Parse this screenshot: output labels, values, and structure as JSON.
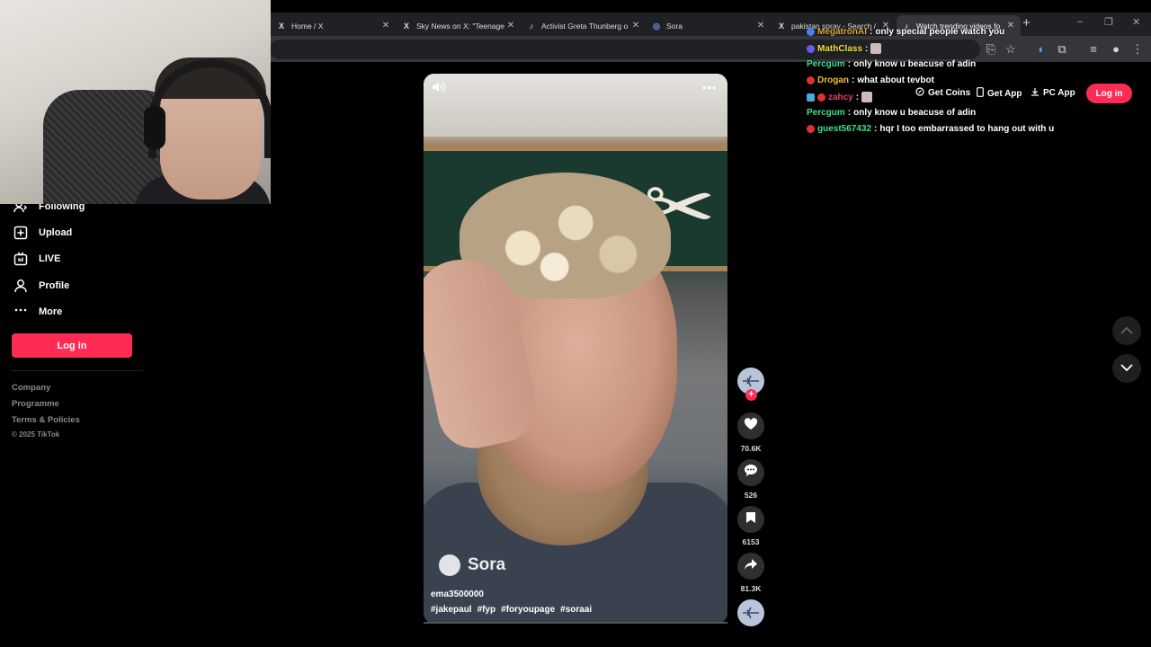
{
  "browser": {
    "tabs": [
      {
        "title": "Home / X",
        "icon": "X"
      },
      {
        "title": "Sky News on X: \"Teenage",
        "icon": "X"
      },
      {
        "title": "Activist Greta Thunberg o",
        "icon": "♪"
      },
      {
        "title": "Sora",
        "icon": "◎"
      },
      {
        "title": "pakistan spray - Search /",
        "icon": "X"
      },
      {
        "title": "Watch trending videos fo",
        "icon": "♪"
      }
    ],
    "new_tab": "+",
    "window_controls": [
      "–",
      "❐",
      "✕"
    ]
  },
  "sidebar": {
    "items": [
      {
        "label": "Following",
        "icon": "following-icon"
      },
      {
        "label": "Upload",
        "icon": "upload-icon"
      },
      {
        "label": "LIVE",
        "icon": "live-icon"
      },
      {
        "label": "Profile",
        "icon": "profile-icon"
      },
      {
        "label": "More",
        "icon": "more-icon"
      }
    ],
    "login_label": "Log in",
    "footer": {
      "company": "Company",
      "programme": "Programme",
      "terms": "Terms & Policies",
      "copyright": "© 2025 TikTok"
    }
  },
  "header": {
    "get_coins": "Get Coins",
    "get_app": "Get App",
    "pc_app": "PC App",
    "login_label": "Log in"
  },
  "video": {
    "watermark": "Sora",
    "author": "ema3500000",
    "hashtags": [
      "#jakepaul",
      "#fyp",
      "#foryoupage",
      "#soraai"
    ],
    "likes": "70.6K",
    "comments": "526",
    "saves": "6153",
    "shares": "81.3K"
  },
  "chat": [
    {
      "user": "MegatronAI",
      "color": "#e0a040",
      "message": "only special people watch you",
      "badge": "#4a7df0"
    },
    {
      "user": "MathClass",
      "color": "#f0e040",
      "message": "",
      "badge": "#6a5cf0",
      "emote": true
    },
    {
      "user": "Percgum",
      "color": "#3ee08a",
      "message": "only know u beacuse of adin",
      "badge": ""
    },
    {
      "user": "Drogan",
      "color": "#f0c030",
      "message": "what about tevbot",
      "badge": "#e03030"
    },
    {
      "user": "zahcy",
      "color": "#e04060",
      "message": "",
      "badge": "#e03030",
      "emote": true
    },
    {
      "user": "Percgum",
      "color": "#3ee08a",
      "message": "only know u beacuse of adin",
      "badge": ""
    },
    {
      "user": "guest567432",
      "color": "#3ee08a",
      "message": "hqr I too embarrassed to hang out with u",
      "badge": "#e03030"
    }
  ],
  "colors": {
    "brand": "#fe2c55",
    "background": "#000000"
  }
}
